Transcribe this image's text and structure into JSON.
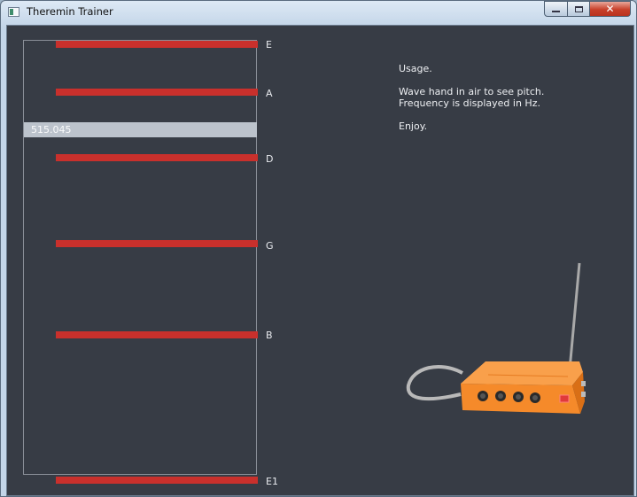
{
  "window": {
    "title": "Theremin Trainer",
    "controls": [
      "minimize",
      "maximize",
      "close"
    ]
  },
  "staff": {
    "notes": [
      {
        "label": "E"
      },
      {
        "label": "A"
      },
      {
        "label": "D"
      },
      {
        "label": "G"
      },
      {
        "label": "B"
      },
      {
        "label": "E1"
      }
    ],
    "note_color": "#c9302c",
    "frequency_readout": "515.045"
  },
  "usage": {
    "heading": "Usage.",
    "line1": "Wave hand in air to see pitch.",
    "line2": "Frequency is displayed in Hz.",
    "closing": "Enjoy."
  },
  "colors": {
    "background": "#373c45",
    "theremin_body": "#f58a2a",
    "readout_bar": "#bcc3cc"
  },
  "icons": {
    "app": "app-window-icon",
    "illustration": "theremin-icon"
  }
}
